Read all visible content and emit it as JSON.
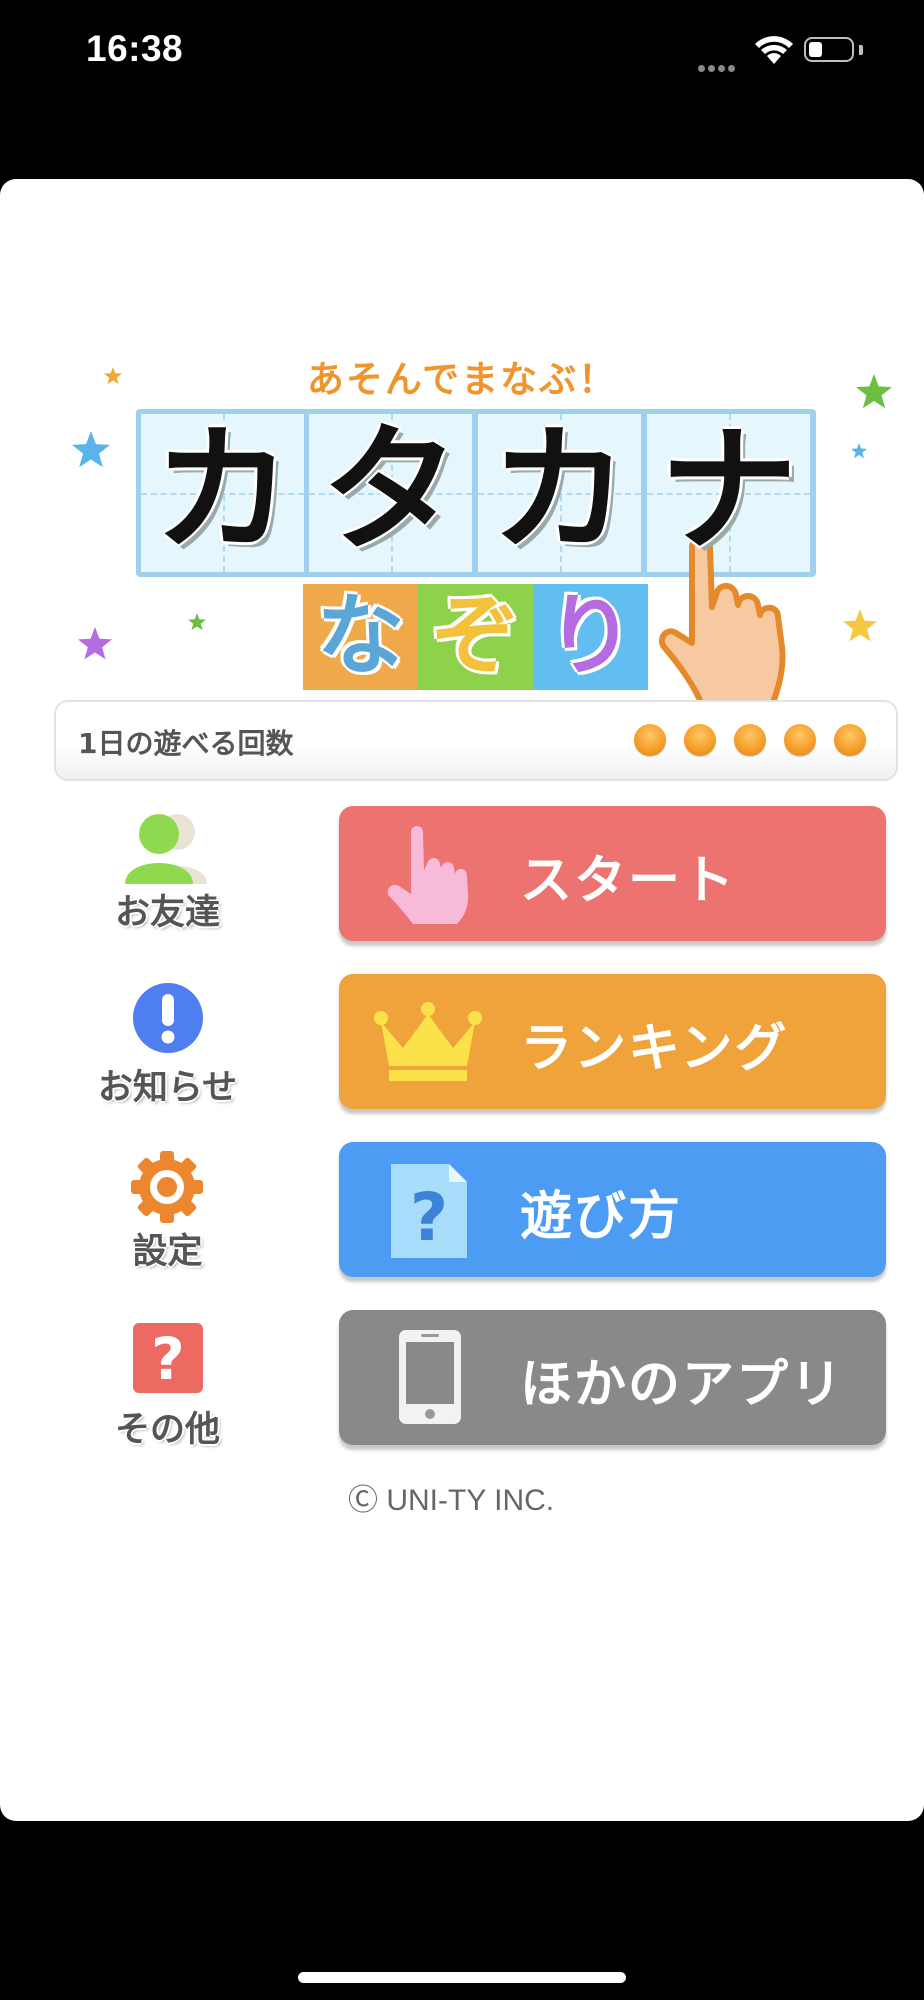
{
  "status_bar": {
    "time": "16:38"
  },
  "logo": {
    "subtitle": "あそんでまなぶ！",
    "kana": [
      "カ",
      "タ",
      "カ",
      "ナ"
    ],
    "nazori": [
      "な",
      "ぞ",
      "り"
    ],
    "nazori_colors": [
      "#f0a94a",
      "#8ed14b",
      "#62bdf0"
    ]
  },
  "daily_plays": {
    "label": "1日の遊べる回数",
    "remaining": 5,
    "max": 5
  },
  "side_menu": [
    {
      "label": "お友達",
      "icon": "friends-icon"
    },
    {
      "label": "お知らせ",
      "icon": "info-icon"
    },
    {
      "label": "設定",
      "icon": "gear-icon"
    },
    {
      "label": "その他",
      "icon": "question-icon"
    }
  ],
  "buttons": [
    {
      "label": "スタート",
      "icon": "pointing-hand-icon",
      "color": "#ec7370"
    },
    {
      "label": "ランキング",
      "icon": "crown-icon",
      "color": "#f0a23b"
    },
    {
      "label": "遊び方",
      "icon": "help-document-icon",
      "color": "#4b9cf2"
    },
    {
      "label": "ほかのアプリ",
      "icon": "smartphone-icon",
      "color": "#898989"
    }
  ],
  "copyright": "Ⓒ UNI-TY INC."
}
